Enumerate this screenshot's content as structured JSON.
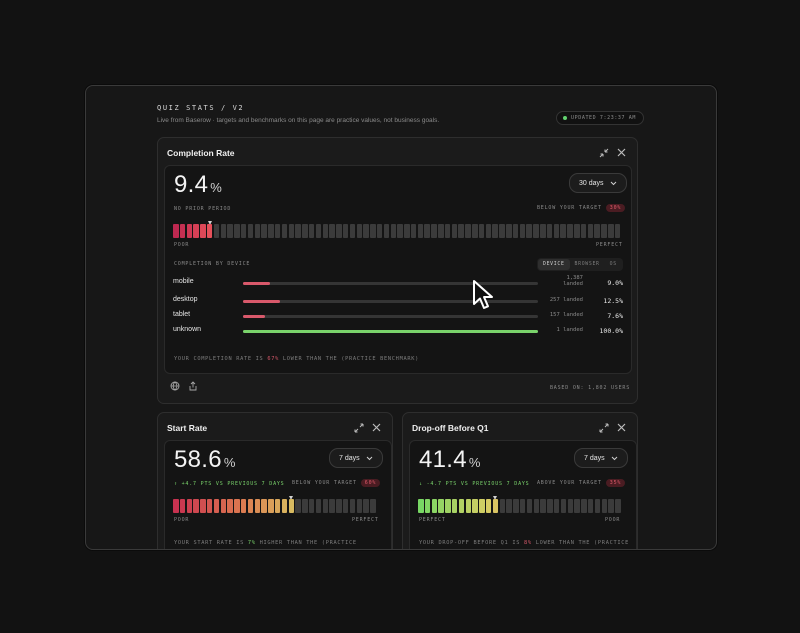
{
  "header": {
    "title": "QUIZ STATS / V2",
    "subtitle": "Live from Baserow · targets and benchmarks on this page are practice values, not business goals.",
    "updated": "UPDATED 7:23:37 AM"
  },
  "completion": {
    "title": "Completion Rate",
    "value": "9.4",
    "unit": "%",
    "period": "30 days",
    "prior": "NO PRIOR PERIOD",
    "target_label": "BELOW YOUR TARGET",
    "target_value": "30%",
    "meter_level": 0.094,
    "scale_low": "POOR",
    "scale_high": "PERFECT",
    "by_device_label": "COMPLETION BY DEVICE",
    "tabs": [
      "DEVICE",
      "BROWSER",
      "OS"
    ],
    "devices": [
      {
        "name": "mobile",
        "landed": "1,387 landed",
        "pct": "9.0%",
        "fraction": 0.09
      },
      {
        "name": "desktop",
        "landed": "257 landed",
        "pct": "12.5%",
        "fraction": 0.125
      },
      {
        "name": "tablet",
        "landed": "157 landed",
        "pct": "7.6%",
        "fraction": 0.076
      },
      {
        "name": "unknown",
        "landed": "1 landed",
        "pct": "100.0%",
        "fraction": 1.0
      }
    ],
    "foot_pre": "YOUR COMPLETION RATE IS",
    "foot_hl": "67%",
    "foot_post": "LOWER THAN THE (PRACTICE BENCHMARK)",
    "based_on": "BASED ON: 1,802 USERS"
  },
  "start": {
    "title": "Start Rate",
    "value": "58.6",
    "unit": "%",
    "period": "7 days",
    "delta": "↑ +4.7 PTS VS PREVIOUS 7 DAYS",
    "target_label": "BELOW YOUR TARGET",
    "target_value": "60%",
    "meter_level": 0.586,
    "scale_low": "POOR",
    "scale_high": "PERFECT",
    "foot_pre": "YOUR START RATE IS",
    "foot_hl": "7%",
    "foot_post": "HIGHER THAN THE (PRACTICE"
  },
  "dropoff": {
    "title": "Drop-off Before Q1",
    "value": "41.4",
    "unit": "%",
    "period": "7 days",
    "delta": "↓ -4.7 PTS VS PREVIOUS 7 DAYS",
    "target_label": "ABOVE YOUR TARGET",
    "target_value": "35%",
    "meter_level": 0.414,
    "scale_low": "PERFECT",
    "scale_high": "POOR",
    "foot_pre": "YOUR DROP-OFF BEFORE Q1 IS",
    "foot_hl": "8%",
    "foot_post": "LOWER THAN THE (PRACTICE"
  },
  "colors": {
    "accent_red": "#d9596b",
    "accent_green": "#7ad36b",
    "status_dot": "#62d26f"
  }
}
